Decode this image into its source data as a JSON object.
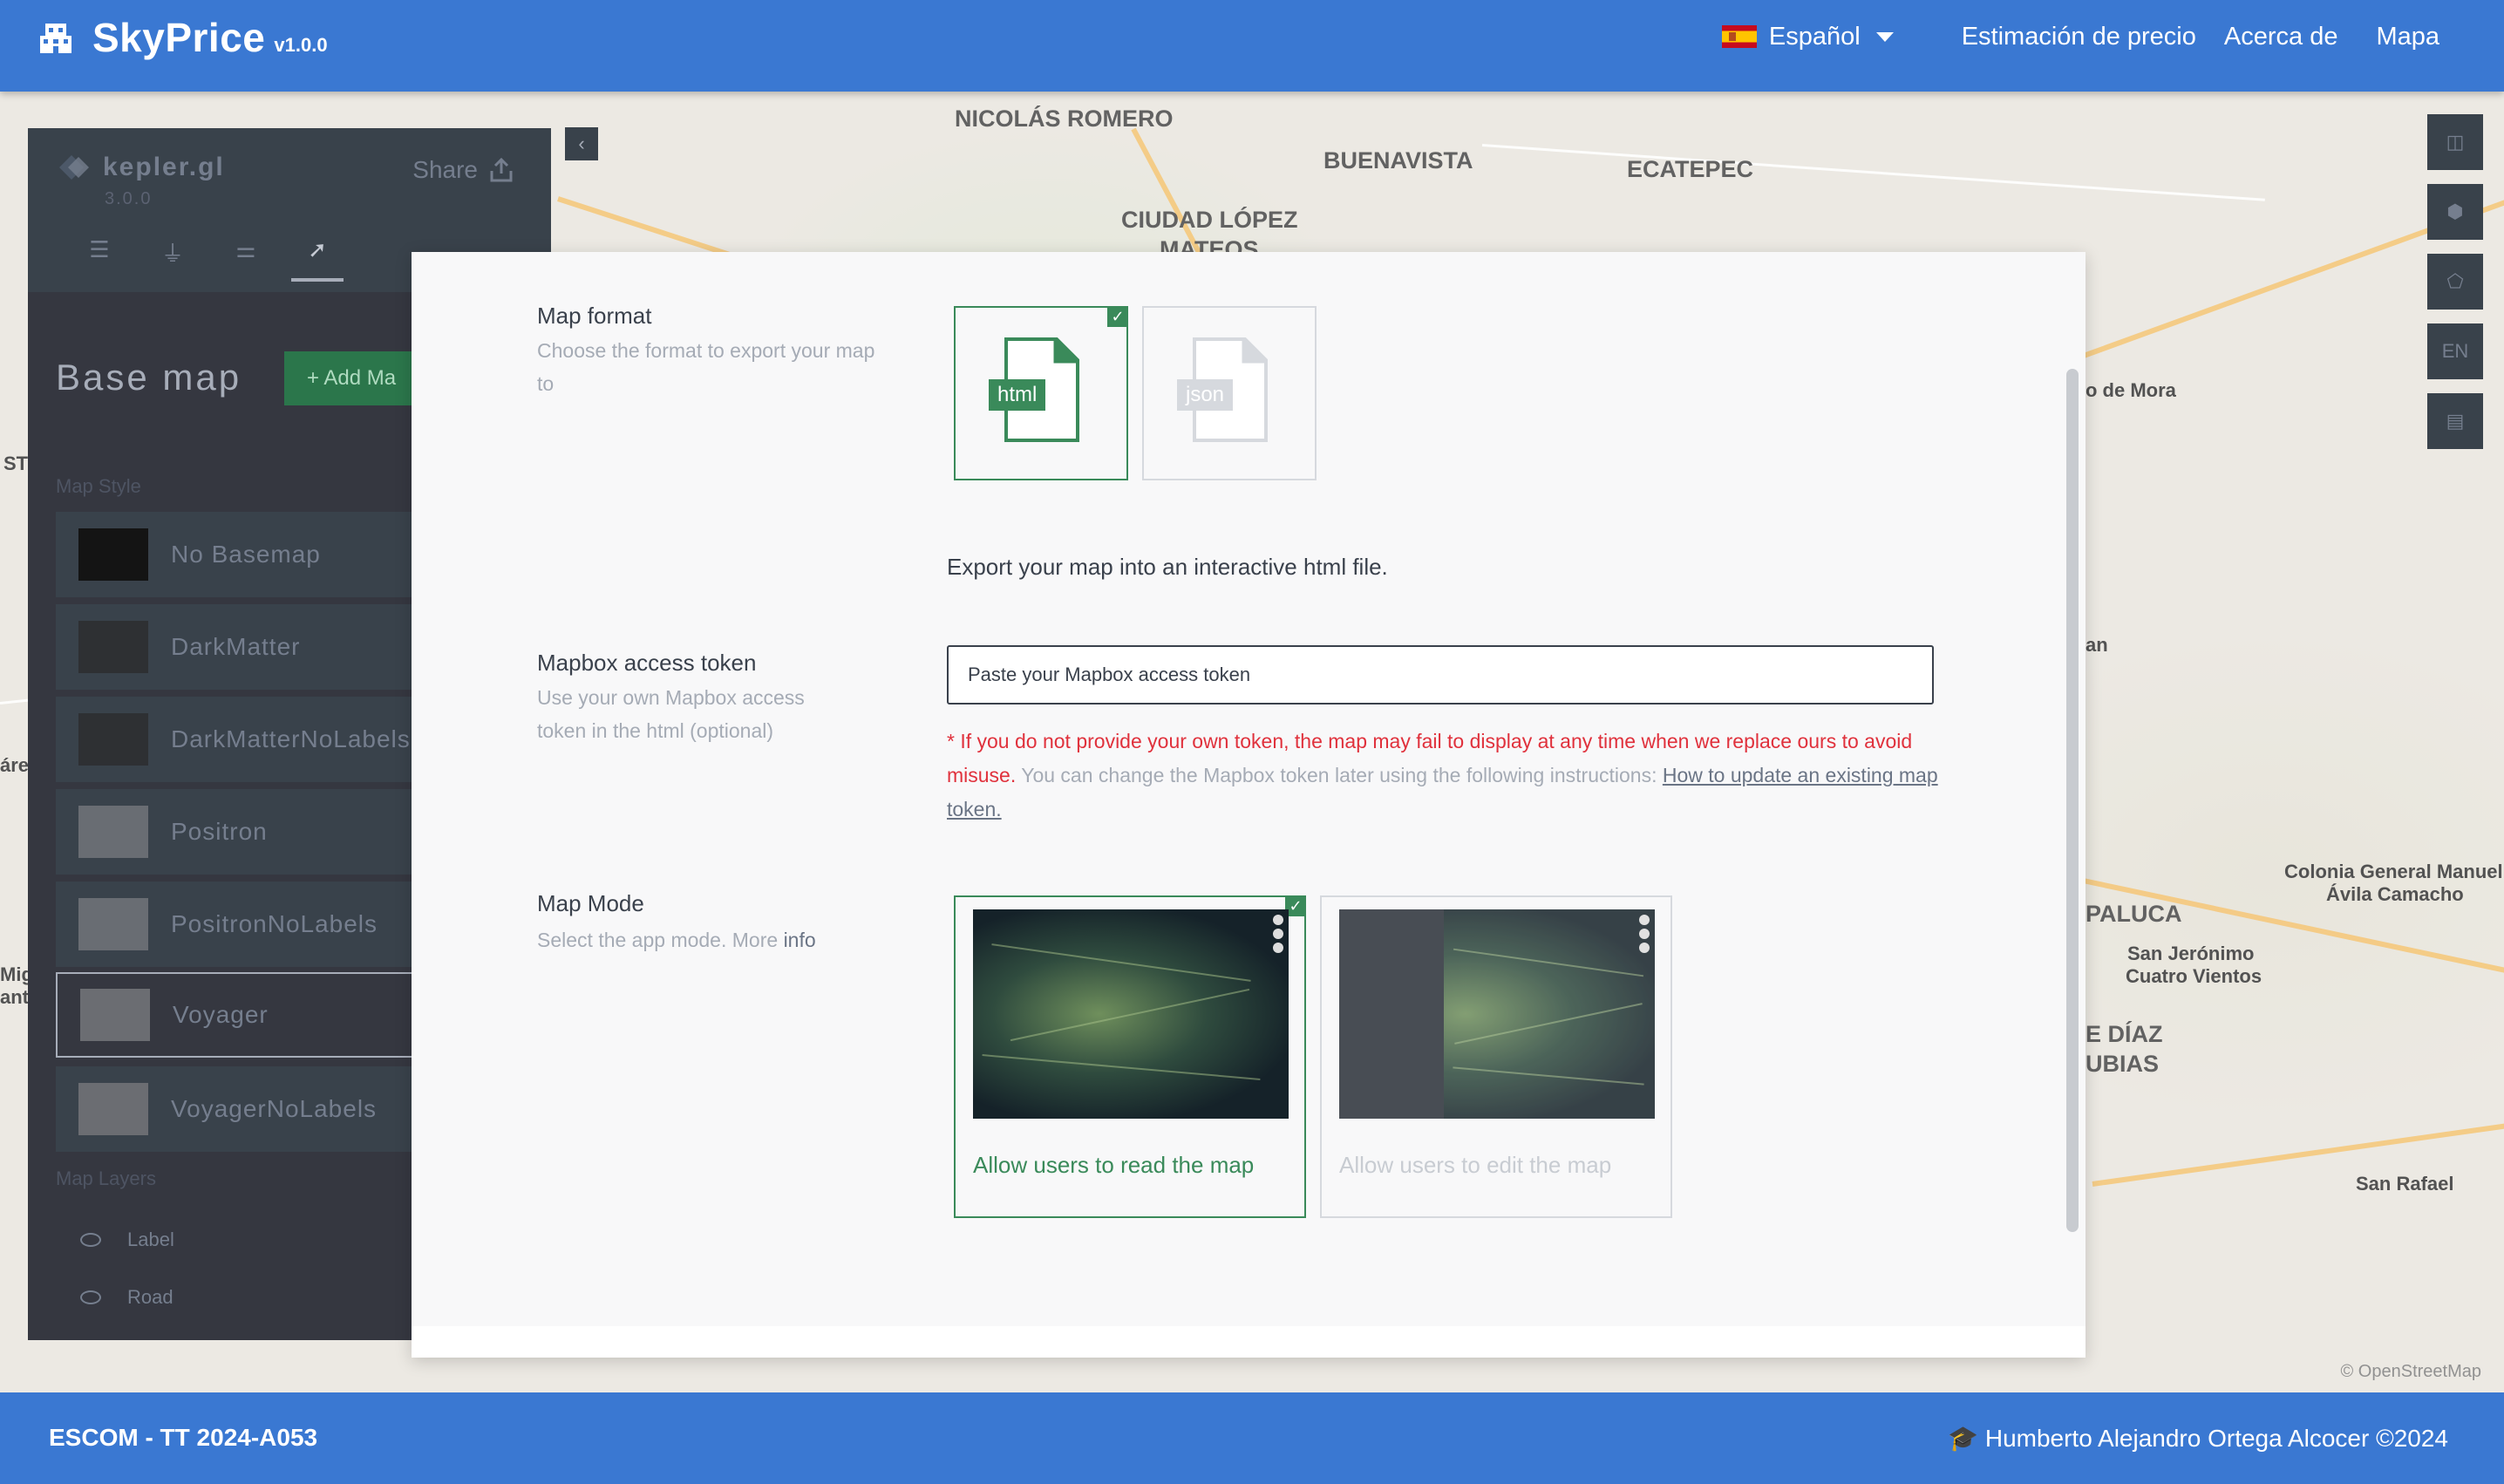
{
  "navbar": {
    "brand": "SkyPrice",
    "version": "v1.0.0",
    "language": "Español",
    "links": [
      "Estimación de precio",
      "Acerca de",
      "Mapa"
    ]
  },
  "map": {
    "labels": [
      {
        "text": "NICOLÁS ROMERO"
      },
      {
        "text": "BUENAVISTA"
      },
      {
        "text": "ECATEPEC"
      },
      {
        "text": "CIUDAD LÓPEZ"
      },
      {
        "text": "MATEOS"
      },
      {
        "text": "o de Mora"
      },
      {
        "text": "an"
      },
      {
        "text": "Colonia General Manuel"
      },
      {
        "text": "Ávila Camacho"
      },
      {
        "text": "PALUCA"
      },
      {
        "text": "San Jerónimo"
      },
      {
        "text": "Cuatro Vientos"
      },
      {
        "text": "E DÍAZ"
      },
      {
        "text": "UBIAS"
      },
      {
        "text": "San Rafael"
      },
      {
        "text": "ST"
      },
      {
        "text": "áre"
      },
      {
        "text": "Mig"
      },
      {
        "text": "ant"
      }
    ],
    "attribution": "© OpenStreetMap",
    "toolbar_lang": "EN"
  },
  "kepler": {
    "name": "kepler.gl",
    "version": "3.0.0",
    "share": "Share",
    "panel_title": "Base map",
    "add_button": "+ Add Ma",
    "map_style_label": "Map Style",
    "styles": [
      "No Basemap",
      "DarkMatter",
      "DarkMatterNoLabels",
      "Positron",
      "PositronNoLabels",
      "Voyager",
      "VoyagerNoLabels"
    ],
    "selected_style": "Voyager",
    "map_layers_label": "Map Layers",
    "layers": [
      "Label",
      "Road"
    ]
  },
  "modal": {
    "map_format": {
      "title": "Map format",
      "desc": "Choose the format to export your map to",
      "options": [
        "html",
        "json"
      ],
      "selected": "html"
    },
    "export_text": "Export your map into an interactive html file.",
    "token": {
      "title": "Mapbox access token",
      "desc": "Use your own Mapbox access token in the html (optional)",
      "placeholder": "Paste your Mapbox access token",
      "warn_red": "* If you do not provide your own token, the map may fail to display at any time when we replace ours to avoid misuse.",
      "warn_grey": " You can change the Mapbox token later using the following instructions: ",
      "warn_link": "How to update an existing map token."
    },
    "map_mode": {
      "title": "Map Mode",
      "desc": "Select the app mode. More ",
      "desc_link": "info",
      "options": [
        "Allow users to read the map",
        "Allow users to edit the map"
      ],
      "selected": "Allow users to read the map"
    }
  },
  "footer": {
    "left": "ESCOM - TT 2024-A053",
    "right": "🎓 Humberto Alejandro Ortega Alcocer ©2024"
  },
  "colors": {
    "primary": "#3a78d2",
    "accent": "#3a8a5a",
    "warning": "#e0313c",
    "kepler_dark": "#242730"
  }
}
